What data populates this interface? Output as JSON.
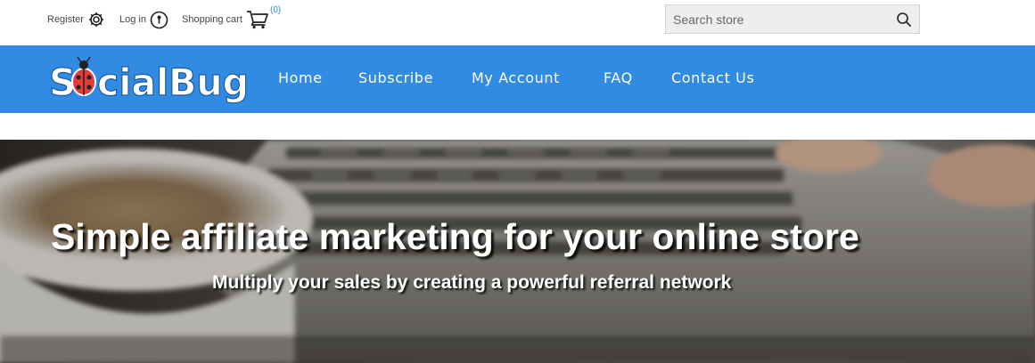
{
  "header": {
    "register_label": "Register",
    "login_label": "Log in",
    "cart_label": "Shopping cart",
    "cart_count": "(0)",
    "search_placeholder": "Search store"
  },
  "brand": {
    "logo_text_part1": "S",
    "logo_text_part2": "cialBug",
    "nav_color": "#318be3",
    "accent_color": "#2e86de"
  },
  "nav": {
    "items": [
      "Home",
      "Subscribe",
      "My Account",
      "FAQ",
      "Contact Us"
    ]
  },
  "hero": {
    "title": "Simple affiliate marketing for your online store",
    "subtitle": "Multiply your sales by creating a powerful referral network"
  },
  "icons": {
    "register": "gear-icon",
    "login": "key-icon",
    "cart": "cart-icon",
    "search": "search-icon",
    "logo_mark": "ladybug-icon"
  }
}
